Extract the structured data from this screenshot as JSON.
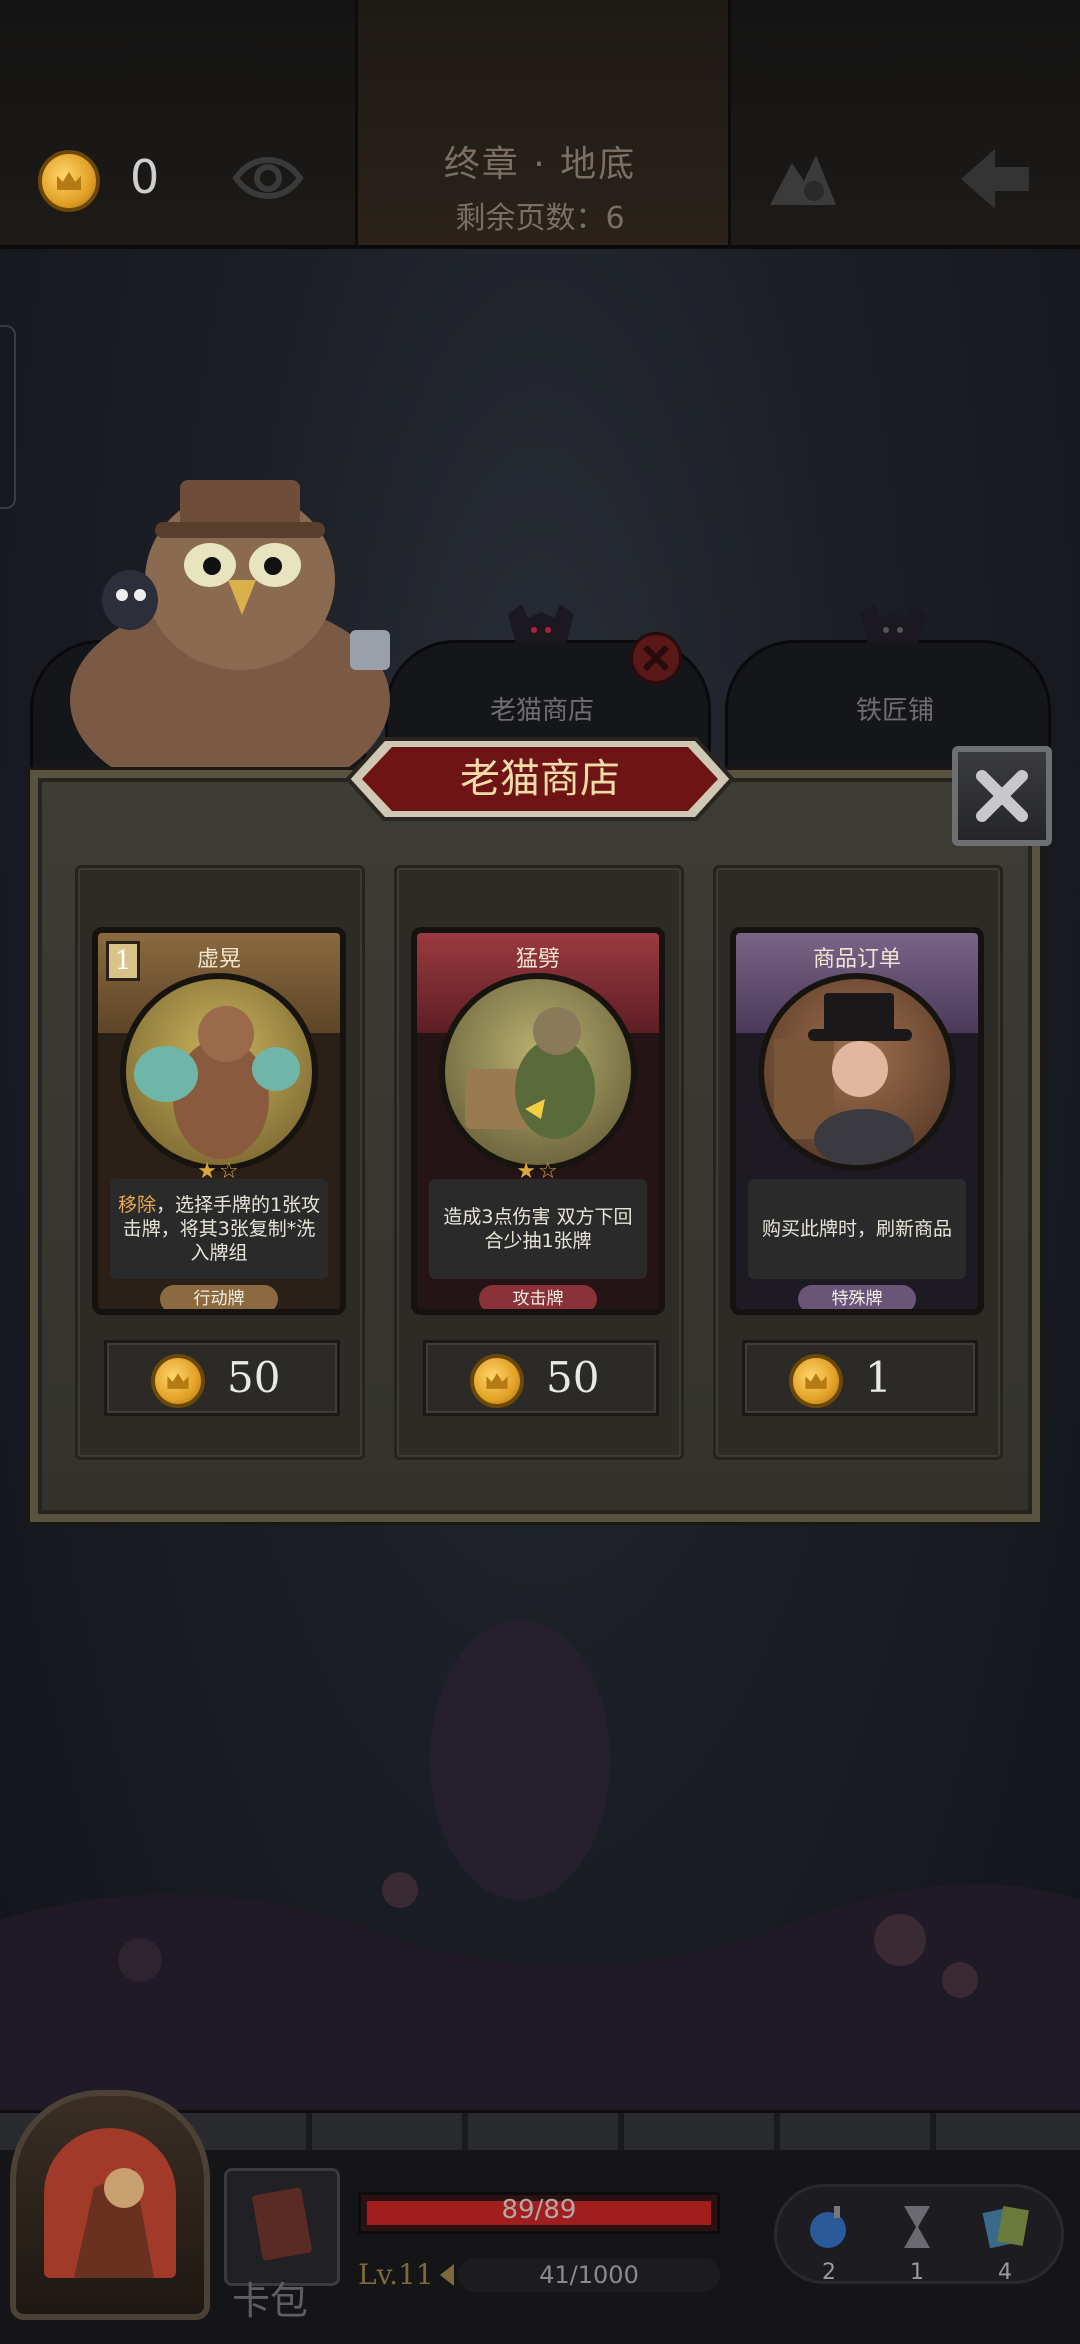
{
  "header": {
    "gold": "0",
    "chapter": "终章 · 地底",
    "remaining_pages": "剩余页数：6"
  },
  "tabs": {
    "shop": "老猫商店",
    "blacksmith": "铁匠铺"
  },
  "shop": {
    "title": "老猫商店",
    "cards": [
      {
        "name": "虚晃",
        "cost": "1",
        "stars": "★☆",
        "desc_highlight": "移除",
        "desc_rest": "，选择手牌的1张攻击牌，将其3张复制*洗入牌组",
        "type": "行动牌",
        "price": "50",
        "color": "#8a6a3e"
      },
      {
        "name": "猛劈",
        "stars": "★☆",
        "desc": "造成3点伤害 双方下回合少抽1张牌",
        "type": "攻击牌",
        "price": "50",
        "color": "#8a3238"
      },
      {
        "name": "商品订单",
        "desc": "购买此牌时，刷新商品",
        "type": "特殊牌",
        "price": "1",
        "color": "#6a5478"
      }
    ]
  },
  "footer": {
    "card_bag": "卡包",
    "hp": "89/89",
    "hp_fraction": 1.0,
    "level": "Lv.11",
    "xp": "41/1000",
    "items": [
      "2",
      "1",
      "4"
    ]
  }
}
